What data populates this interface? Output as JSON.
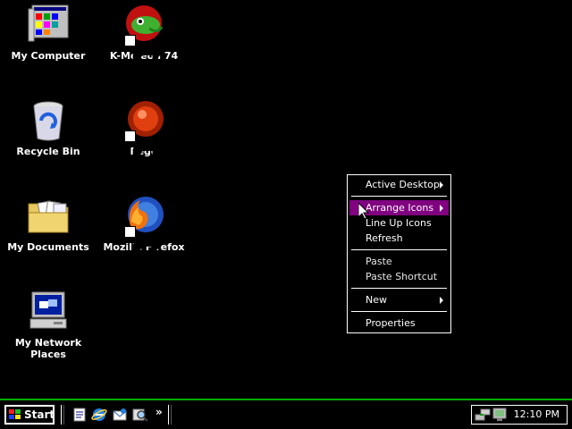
{
  "desktop": {
    "icons": [
      {
        "label": "My Computer"
      },
      {
        "label": "K-Meleon 74"
      },
      {
        "label": "Recycle Bin"
      },
      {
        "label": "Pego"
      },
      {
        "label": "My Documents"
      },
      {
        "label": "Mozilla Firefox"
      },
      {
        "label": "My Network Places"
      }
    ]
  },
  "context_menu": {
    "items": [
      {
        "label": "Active Desktop",
        "submenu": true
      },
      {
        "label": "Arrange Icons",
        "submenu": true,
        "highlighted": true
      },
      {
        "label": "Line Up Icons"
      },
      {
        "label": "Refresh"
      },
      {
        "label": "Paste",
        "disabled": true
      },
      {
        "label": "Paste Shortcut",
        "disabled": true
      },
      {
        "label": "New",
        "submenu": true
      },
      {
        "label": "Properties"
      }
    ]
  },
  "taskbar": {
    "start_label": "Start",
    "quick_launch_more": "»",
    "quick_launch": [
      "notepad-icon",
      "internet-explorer-icon",
      "outlook-express-icon",
      "search-icon"
    ],
    "tray": {
      "icons": [
        "network-icon",
        "display-icon"
      ],
      "clock": "12:10 PM"
    }
  },
  "colors": {
    "background": "#000000",
    "taskbar_border": "#00b000",
    "menu_highlight": "#800080",
    "text": "#ffffff"
  }
}
